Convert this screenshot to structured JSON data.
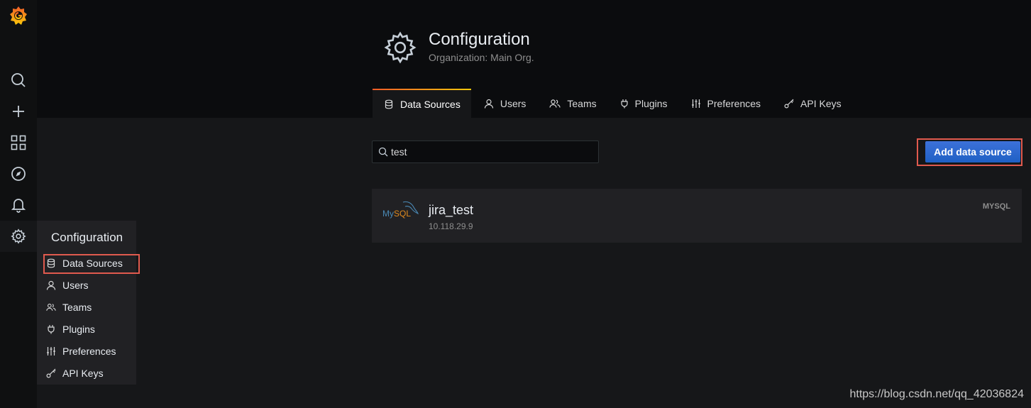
{
  "sidebar": {
    "icons": [
      "grafana-logo-icon",
      "search-icon",
      "plus-icon",
      "dashboards-icon",
      "explore-icon",
      "alerting-bell-icon",
      "gear-icon"
    ]
  },
  "header": {
    "title": "Configuration",
    "subtitle": "Organization: Main Org."
  },
  "tabs": [
    {
      "label": "Data Sources",
      "icon": "database-icon",
      "active": true
    },
    {
      "label": "Users",
      "icon": "user-icon"
    },
    {
      "label": "Teams",
      "icon": "users-icon"
    },
    {
      "label": "Plugins",
      "icon": "plug-icon"
    },
    {
      "label": "Preferences",
      "icon": "sliders-icon"
    },
    {
      "label": "API Keys",
      "icon": "key-icon"
    }
  ],
  "search": {
    "value": "test"
  },
  "add_button": {
    "label": "Add data source"
  },
  "datasource": {
    "logo_my": "My",
    "logo_sql": "SQL",
    "name": "jira_test",
    "url": "10.118.29.9",
    "type": "MYSQL"
  },
  "flyout": {
    "title": "Configuration",
    "items": [
      {
        "label": "Data Sources",
        "icon": "database-icon"
      },
      {
        "label": "Users",
        "icon": "user-icon"
      },
      {
        "label": "Teams",
        "icon": "users-icon"
      },
      {
        "label": "Plugins",
        "icon": "plug-icon"
      },
      {
        "label": "Preferences",
        "icon": "sliders-icon"
      },
      {
        "label": "API Keys",
        "icon": "key-icon"
      }
    ]
  },
  "watermark": "https://blog.csdn.net/qq_42036824",
  "colors": {
    "accent": "#eb7b18",
    "primary_button": "#3274d9",
    "highlight_box": "#e05a4e"
  }
}
